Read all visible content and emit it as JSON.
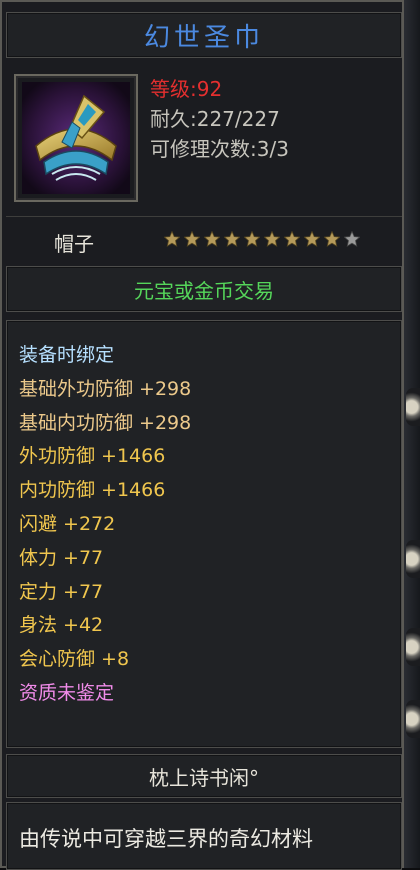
{
  "item": {
    "name": "幻世圣巾",
    "level": "等级:92",
    "durability": "耐久:227/227",
    "repairs": "可修理次数:3/3",
    "type": "帽子",
    "stars": {
      "filled": 9,
      "total": 10
    },
    "trade": "元宝或金币交易"
  },
  "attributes": [
    {
      "text": "装备时绑定",
      "color": "#b6e0ff"
    },
    {
      "text": "基础外功防御 +298",
      "color": "#ecc98b"
    },
    {
      "text": "基础内功防御 +298",
      "color": "#ecc98b"
    },
    {
      "text": "外功防御 +1466",
      "color": "#f0c64e"
    },
    {
      "text": "内功防御 +1466",
      "color": "#f0c64e"
    },
    {
      "text": "闪避 +272",
      "color": "#f0c64e"
    },
    {
      "text": "体力 +77",
      "color": "#f0c64e"
    },
    {
      "text": "定力 +77",
      "color": "#f0c64e"
    },
    {
      "text": "身法 +42",
      "color": "#f0c64e"
    },
    {
      "text": "会心防御 +8",
      "color": "#f0c64e"
    },
    {
      "text": "资质未鉴定",
      "color": "#f08be9"
    }
  ],
  "owner": "枕上诗书闲°",
  "description": "由传说中可穿越三界的奇幻材料",
  "icon": "helmet-headscarf-icon",
  "colors": {
    "title": "#4b89e0",
    "trade": "#55d65a",
    "level": "#e42f2f",
    "star_filled": "#b59a5a",
    "star_empty": "#9a9a9a"
  }
}
